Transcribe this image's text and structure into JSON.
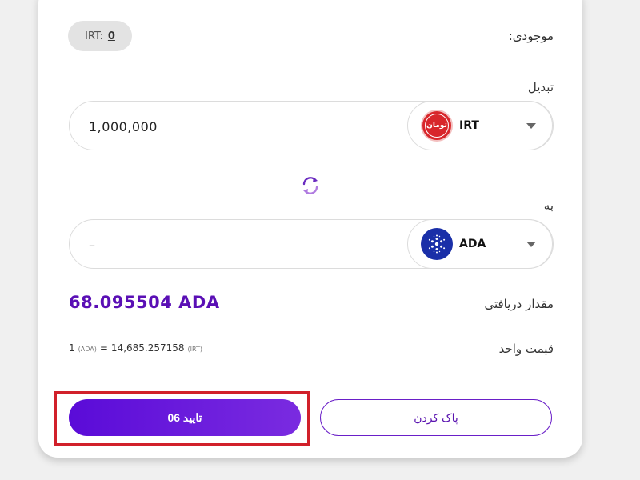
{
  "balance": {
    "label": "موجودی:",
    "currency": "IRT:",
    "amount": "0"
  },
  "exchange": {
    "from_label": "تبدیل",
    "from_value": "1,000,000",
    "from_currency": "IRT",
    "from_logo_text": "تومان",
    "to_label": "به",
    "to_value": "–",
    "to_currency": "ADA"
  },
  "receive": {
    "label": "مقدار دریافتی",
    "amount": "68.095504 ADA"
  },
  "unit_price": {
    "label": "قیمت واحد",
    "left_qty": "1",
    "left_unit": "(ADA)",
    "equals": "=",
    "right_qty": "14,685.257158",
    "right_unit": "(IRT)"
  },
  "buttons": {
    "confirm": "تایید 06",
    "clear": "پاک کردن"
  },
  "colors": {
    "accent": "#5a0bd8",
    "highlight": "#d1202a"
  },
  "icons": {
    "swap": "swap-arrows-icon",
    "dropdown": "chevron-down-icon"
  }
}
